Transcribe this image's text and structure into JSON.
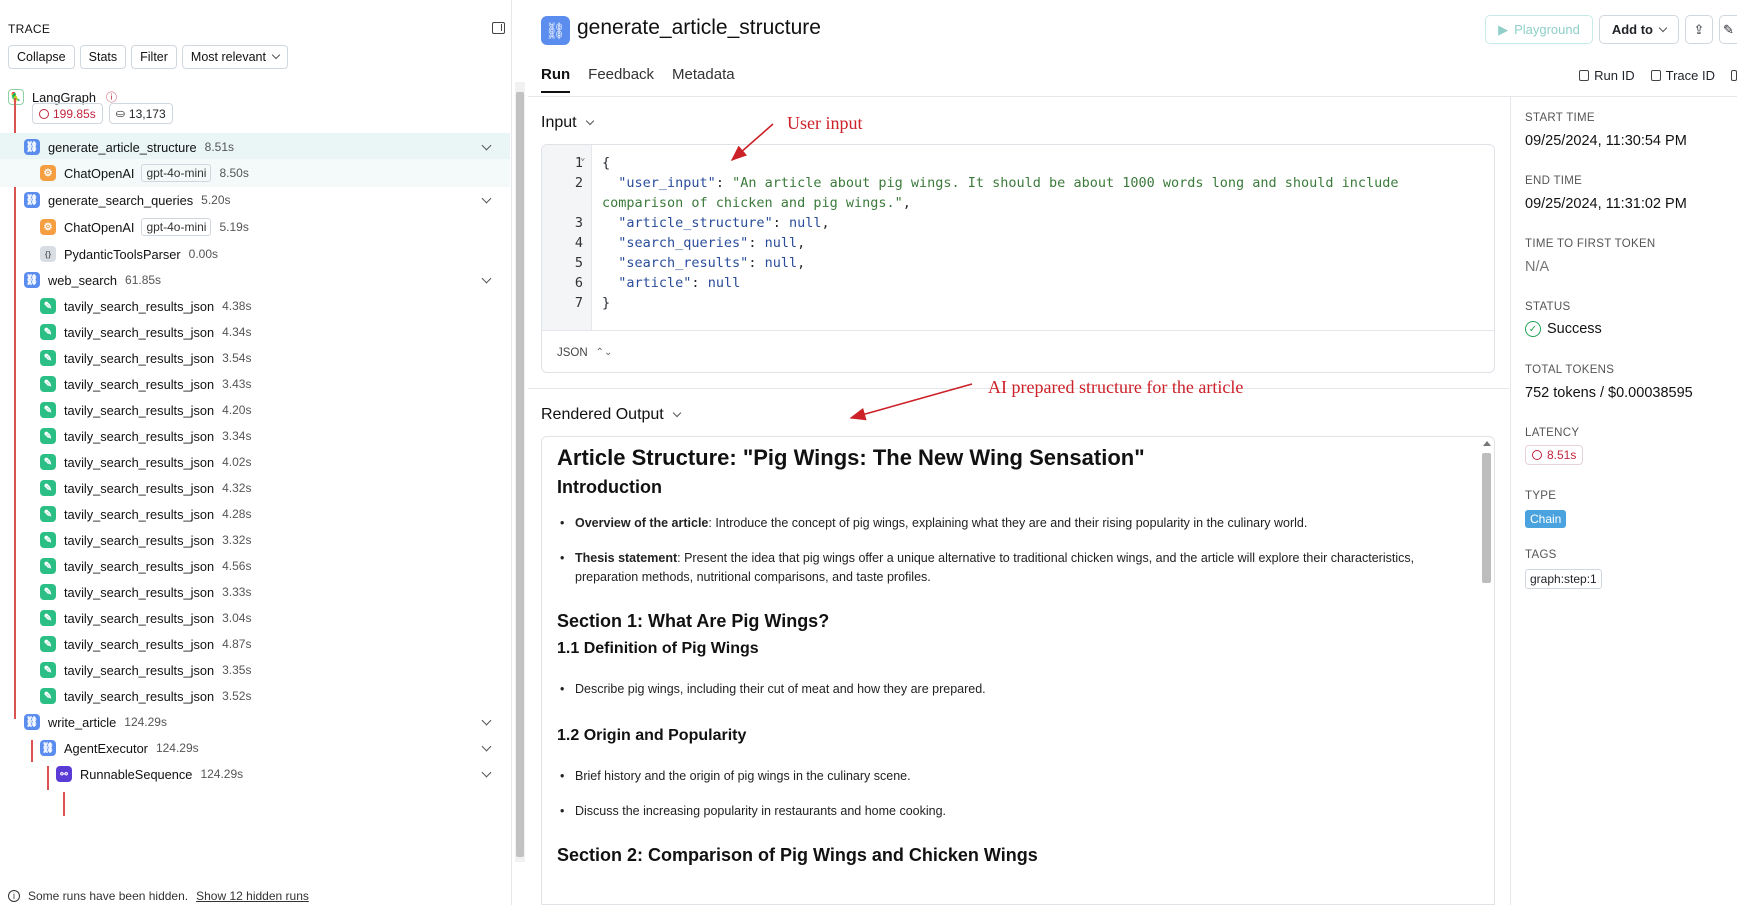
{
  "trace": {
    "heading": "TRACE",
    "toolbar": {
      "collapse": "Collapse",
      "stats": "Stats",
      "filter": "Filter",
      "sort": "Most relevant"
    },
    "root": {
      "name": "LangGraph",
      "latency": "199.85s",
      "tokens": "13,173"
    },
    "rows": [
      {
        "name": "generate_article_structure",
        "dur": "8.51s",
        "icon": "chain-icon"
      },
      {
        "name": "ChatOpenAI",
        "badge": "gpt-4o-mini",
        "dur": "8.50s",
        "icon": "openai-icon"
      },
      {
        "name": "generate_search_queries",
        "dur": "5.20s",
        "icon": "chain-icon"
      },
      {
        "name": "ChatOpenAI",
        "badge": "gpt-4o-mini",
        "dur": "5.19s",
        "icon": "openai-icon"
      },
      {
        "name": "PydanticToolsParser",
        "dur": "0.00s",
        "icon": "parser-icon"
      },
      {
        "name": "web_search",
        "dur": "61.85s",
        "icon": "chain-icon"
      },
      {
        "name": "tavily_search_results_json",
        "dur": "4.38s",
        "icon": "tool-icon"
      },
      {
        "name": "tavily_search_results_json",
        "dur": "4.34s",
        "icon": "tool-icon"
      },
      {
        "name": "tavily_search_results_json",
        "dur": "3.54s",
        "icon": "tool-icon"
      },
      {
        "name": "tavily_search_results_json",
        "dur": "3.43s",
        "icon": "tool-icon"
      },
      {
        "name": "tavily_search_results_json",
        "dur": "4.20s",
        "icon": "tool-icon"
      },
      {
        "name": "tavily_search_results_json",
        "dur": "3.34s",
        "icon": "tool-icon"
      },
      {
        "name": "tavily_search_results_json",
        "dur": "4.02s",
        "icon": "tool-icon"
      },
      {
        "name": "tavily_search_results_json",
        "dur": "4.32s",
        "icon": "tool-icon"
      },
      {
        "name": "tavily_search_results_json",
        "dur": "4.28s",
        "icon": "tool-icon"
      },
      {
        "name": "tavily_search_results_json",
        "dur": "3.32s",
        "icon": "tool-icon"
      },
      {
        "name": "tavily_search_results_json",
        "dur": "4.56s",
        "icon": "tool-icon"
      },
      {
        "name": "tavily_search_results_json",
        "dur": "3.33s",
        "icon": "tool-icon"
      },
      {
        "name": "tavily_search_results_json",
        "dur": "3.04s",
        "icon": "tool-icon"
      },
      {
        "name": "tavily_search_results_json",
        "dur": "4.87s",
        "icon": "tool-icon"
      },
      {
        "name": "tavily_search_results_json",
        "dur": "3.35s",
        "icon": "tool-icon"
      },
      {
        "name": "tavily_search_results_json",
        "dur": "3.52s",
        "icon": "tool-icon"
      },
      {
        "name": "write_article",
        "dur": "124.29s",
        "icon": "chain-icon"
      },
      {
        "name": "AgentExecutor",
        "dur": "124.29s",
        "icon": "chain-icon"
      },
      {
        "name": "RunnableSequence",
        "dur": "124.29s",
        "icon": "sequence-icon"
      }
    ],
    "hidden_note": "Some runs have been hidden.",
    "hidden_link": "Show 12 hidden runs"
  },
  "header": {
    "title": "generate_article_structure",
    "tabs": [
      "Run",
      "Feedback",
      "Metadata"
    ],
    "actions": {
      "playground": "Playground",
      "add_to": "Add to"
    },
    "run_id": "Run ID",
    "trace_id": "Trace ID"
  },
  "input": {
    "label": "Input",
    "lines": [
      "1",
      "2",
      "",
      "3",
      "4",
      "5",
      "6",
      "7"
    ],
    "format": "JSON",
    "json": {
      "user_input_key": "\"user_input\"",
      "user_input_val_1": "\"An article about pig wings. It should be about 1000 words long and should include",
      "user_input_val_2": "comparison of chicken and pig wings.\"",
      "k_structure": "\"article_structure\"",
      "k_queries": "\"search_queries\"",
      "k_results": "\"search_results\"",
      "k_article": "\"article\"",
      "null": "null"
    }
  },
  "output": {
    "label": "Rendered Output",
    "h1": "Article Structure: \"Pig Wings: The New Wing Sensation\"",
    "intro": "Introduction",
    "b1_bold": "Overview of the article",
    "b1_text": ": Introduce the concept of pig wings, explaining what they are and their rising popularity in the culinary world.",
    "b2_bold": "Thesis statement",
    "b2_text": ": Present the idea that pig wings offer a unique alternative to traditional chicken wings, and the article will explore their characteristics, preparation methods, nutritional comparisons, and taste profiles.",
    "s1": "Section 1: What Are Pig Wings?",
    "s1_1": "1.1 Definition of Pig Wings",
    "s1_1_b": "Describe pig wings, including their cut of meat and how they are prepared.",
    "s1_2": "1.2 Origin and Popularity",
    "s1_2_b1": "Brief history and the origin of pig wings in the culinary scene.",
    "s1_2_b2": "Discuss the increasing popularity in restaurants and home cooking.",
    "s2": "Section 2: Comparison of Pig Wings and Chicken Wings"
  },
  "annotations": {
    "user_input": "User input",
    "ai_structure": "AI prepared structure for the article"
  },
  "meta": {
    "start_label": "START TIME",
    "start": "09/25/2024, 11:30:54 PM",
    "end_label": "END TIME",
    "end": "09/25/2024, 11:31:02 PM",
    "ttft_label": "TIME TO FIRST TOKEN",
    "ttft": "N/A",
    "status_label": "STATUS",
    "status": "Success",
    "tokens_label": "TOTAL TOKENS",
    "tokens": "752 tokens / $0.00038595",
    "latency_label": "LATENCY",
    "latency": "8.51s",
    "type_label": "TYPE",
    "type": "Chain",
    "tags_label": "TAGS",
    "tag": "graph:step:1"
  },
  "colors": {
    "accent": "#5b8def",
    "error": "#c0263d",
    "success": "#23a455",
    "annotation": "#cc2128"
  }
}
